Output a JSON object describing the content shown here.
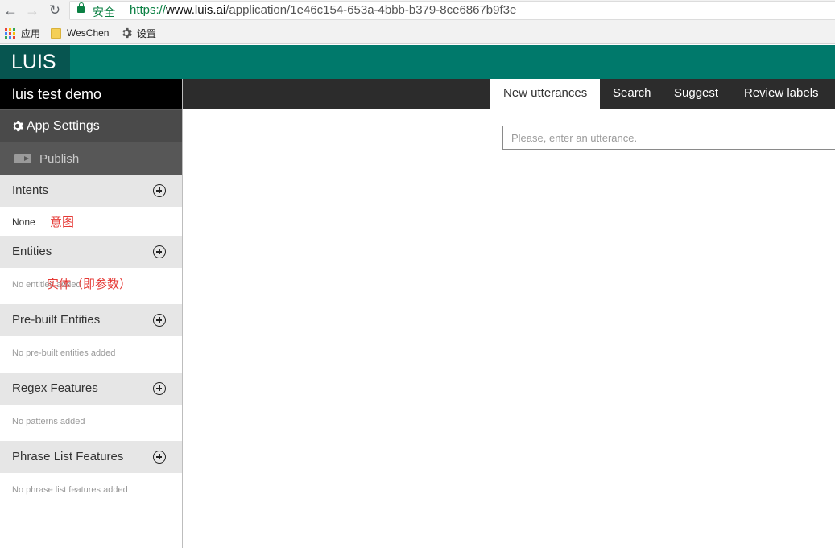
{
  "browser": {
    "secure_label": "安全",
    "url_scheme": "https://",
    "url_host": "www.luis.ai",
    "url_path": "/application/1e46c154-653a-4bbb-b379-8ce6867b9f3e",
    "bookmarks": {
      "apps": "应用",
      "folder": "WesChen",
      "settings": "设置"
    },
    "colors": {
      "secure": "#0b8043",
      "folder": "#f4cf57"
    }
  },
  "header": {
    "logo": "LUIS",
    "colors": {
      "bar": "#00796b",
      "logo_bg": "#075550"
    }
  },
  "sidebar": {
    "app_name": "luis test demo",
    "app_settings": "App Settings",
    "publish": "Publish",
    "sections": {
      "intents": {
        "title": "Intents",
        "item": "None",
        "annotation": "意图"
      },
      "entities": {
        "title": "Entities",
        "empty": "No entities added",
        "annotation": "实体（即参数）"
      },
      "prebuilt": {
        "title": "Pre-built Entities",
        "empty": "No pre-built entities added"
      },
      "regex": {
        "title": "Regex Features",
        "empty": "No patterns added"
      },
      "phrase": {
        "title": "Phrase List Features",
        "empty": "No phrase list features added"
      }
    }
  },
  "main": {
    "tabs": [
      "New utterances",
      "Search",
      "Suggest",
      "Review labels"
    ],
    "active_tab": "New utterances",
    "utterance_placeholder": "Please, enter an utterance.",
    "utterance_value": ""
  }
}
